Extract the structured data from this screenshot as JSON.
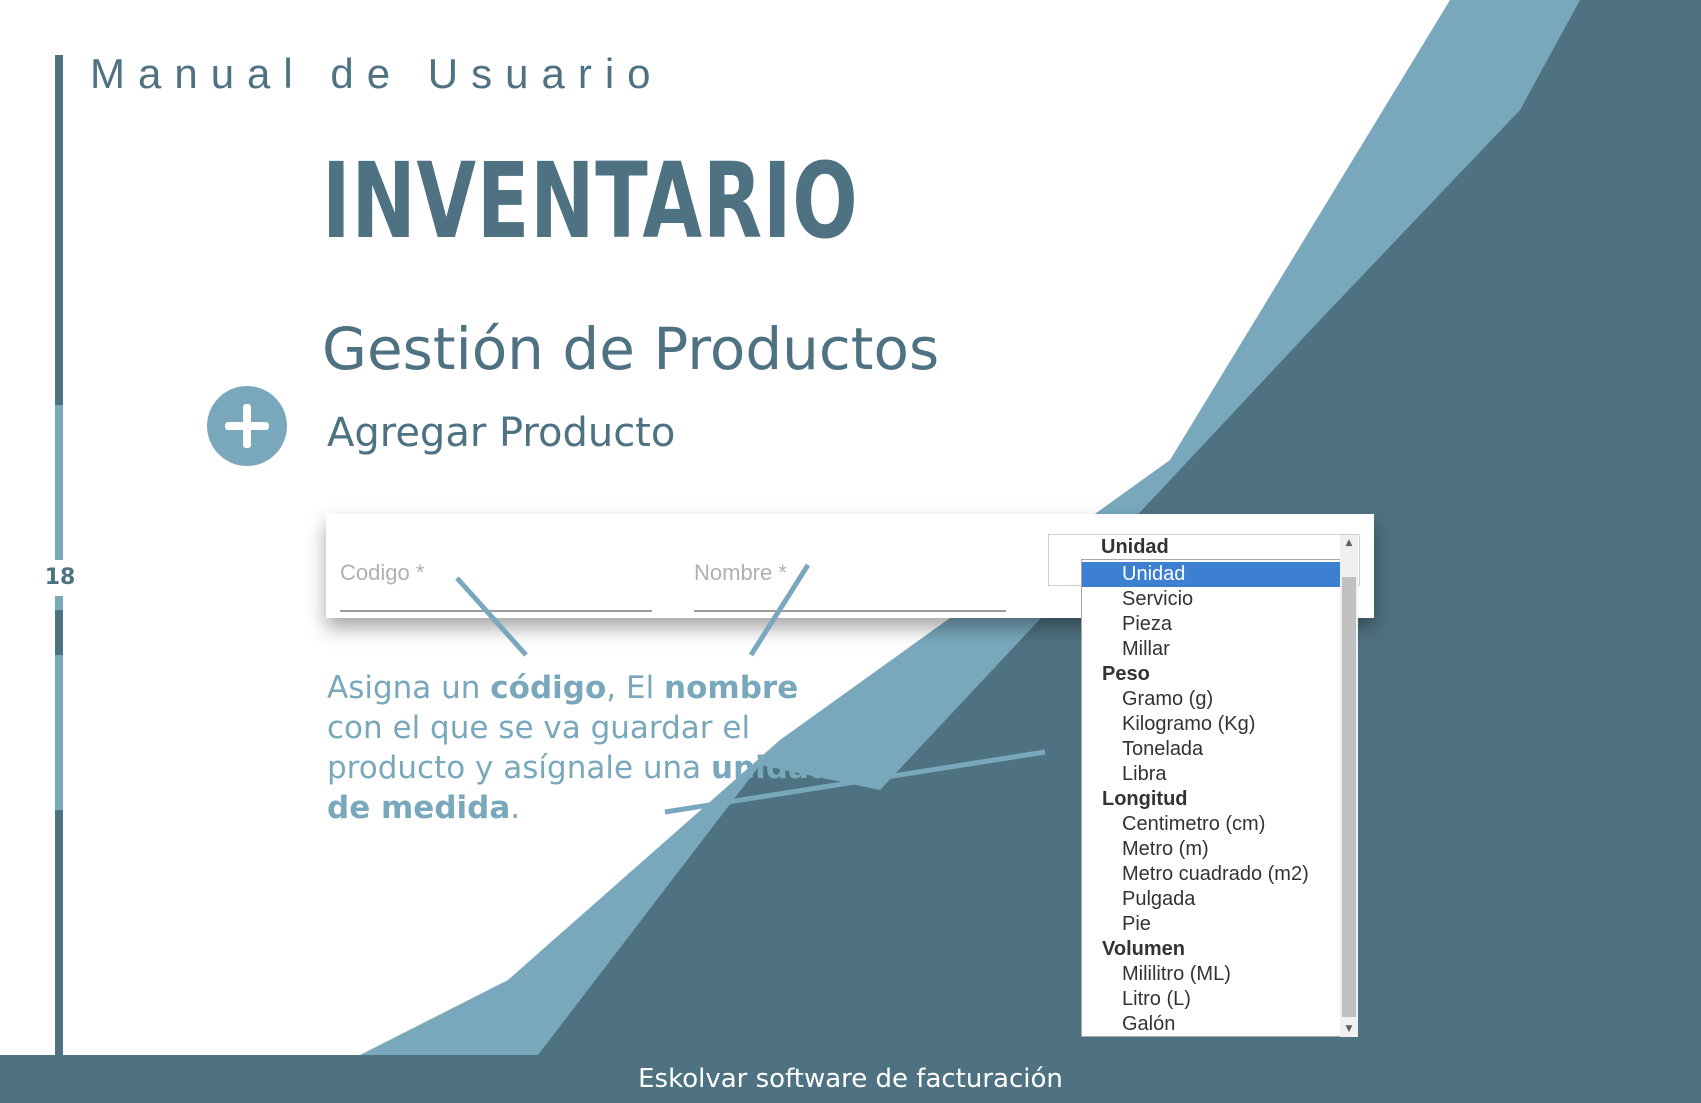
{
  "header": {
    "manual_title": "Manual de Usuario",
    "section_title": "INVENTARIO",
    "subtitle": "Gestión de Productos",
    "action_title": "Agregar Producto",
    "page_number": "18"
  },
  "form": {
    "code_placeholder": "Codigo *",
    "name_placeholder": "Nombre *"
  },
  "unit_dropdown": {
    "groups": [
      {
        "label": "Unidad",
        "options": [
          "Unidad",
          "Servicio",
          "Pieza",
          "Millar"
        ]
      },
      {
        "label": "Peso",
        "options": [
          "Gramo (g)",
          "Kilogramo (Kg)",
          "Tonelada",
          "Libra"
        ]
      },
      {
        "label": "Longitud",
        "options": [
          "Centimetro (cm)",
          "Metro (m)",
          "Metro cuadrado (m2)",
          "Pulgada",
          "Pie"
        ]
      },
      {
        "label": "Volumen",
        "options": [
          "Mililitro (ML)",
          "Litro (L)",
          "Galón"
        ]
      }
    ],
    "selected": "Unidad"
  },
  "description": {
    "p1": "Asigna un ",
    "b1": "código",
    "p2": ", El ",
    "b2": "nombre",
    "p3": " con el que se va guardar el producto y asígnale una ",
    "b3": "unidad de medida",
    "p4": "."
  },
  "footer": {
    "text": "Eskolvar software de facturación"
  },
  "colors": {
    "dark": "#4f7282",
    "light": "#79a8bd",
    "select_blue": "#3d7fd1"
  }
}
